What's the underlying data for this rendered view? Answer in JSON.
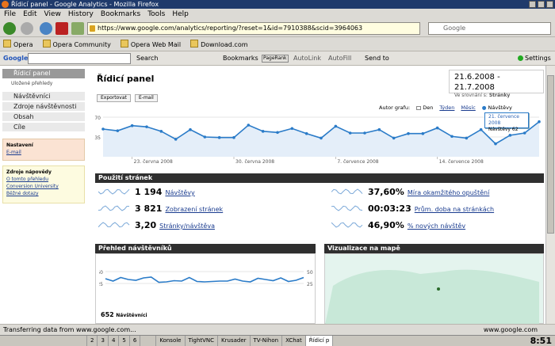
{
  "window": {
    "title": "Řídicí panel - Google Analytics - Mozilla Firefox"
  },
  "menu": [
    "File",
    "Edit",
    "View",
    "History",
    "Bookmarks",
    "Tools",
    "Help"
  ],
  "navbar": {
    "url": "https://www.google.com/analytics/reporting/?reset=1&id=7910388&scid=3964063",
    "search_placeholder": "Google"
  },
  "bookmarks": [
    "Opera",
    "Opera Community",
    "Opera Web Mail",
    "Download.com"
  ],
  "google_toolbar": {
    "logo": "Google",
    "items": [
      "Search",
      "Bookmarks",
      "PageRank",
      "AutoLink",
      "AutoFill",
      "Send to",
      "Settings"
    ]
  },
  "sidebar": {
    "header": "Řídicí panel",
    "saved_reports": "Uložené přehledy",
    "items": [
      "Návštěvníci",
      "Zdroje návštěvnosti",
      "Obsah",
      "Cíle"
    ],
    "settings": {
      "title": "Nastavení",
      "email": "E-mail"
    },
    "help": {
      "title": "Zdroje nápovědy",
      "links": [
        "O tomto přehledu",
        "Conversion University",
        "Běžné dotazy"
      ]
    }
  },
  "main": {
    "title": "Řídicí panel",
    "date_range": "21.6.2008 - 21.7.2008",
    "compare_label": "Ve srovnání s:",
    "compare_value": "Stránky",
    "export_button": "Exportovat",
    "email_button": "E-mail",
    "graph_label": "Autor grafu:",
    "graph_options": [
      "Den",
      "Týden",
      "Měsíc"
    ],
    "metric_selector": "Návštěvy",
    "tooltip": {
      "date": "21. července 2008",
      "value": "Návštěvy 62"
    }
  },
  "chart_data": [
    {
      "type": "line",
      "title": "",
      "series": [
        {
          "name": "Návštěvy",
          "values": [
            49,
            46,
            55,
            53,
            45,
            31,
            48,
            35,
            34,
            34,
            56,
            45,
            43,
            50,
            41,
            33,
            54,
            42,
            42,
            48,
            33,
            41,
            41,
            51,
            36,
            33,
            48,
            23,
            38,
            42,
            62
          ]
        }
      ],
      "x_tick_labels": [
        "23. června 2008",
        "30. června 2008",
        "7. července 2008",
        "14. července 2008"
      ],
      "y_tick_labels": [
        "35",
        "70"
      ],
      "ylim": [
        0,
        70
      ]
    },
    {
      "type": "line",
      "title": "Přehled návštěvníků",
      "series": [
        {
          "name": "",
          "values": [
            42,
            36,
            45,
            40,
            38,
            44,
            46,
            33,
            34,
            37,
            36,
            45,
            35,
            34,
            35,
            36,
            36,
            41,
            36,
            34,
            43,
            40,
            37,
            44,
            35,
            38,
            45
          ]
        }
      ],
      "y_tick_labels": [
        "25",
        "50"
      ],
      "ylim": [
        0,
        60
      ]
    }
  ],
  "page_usage": {
    "title": "Použití stránek",
    "stats": [
      {
        "value": "1 194",
        "label": "Návštěvy"
      },
      {
        "value": "3 821",
        "label": "Zobrazení stránek"
      },
      {
        "value": "3,20",
        "label": "Stránky/návštěva"
      },
      {
        "value": "37,60%",
        "label": "Míra okamžitého opuštění"
      },
      {
        "value": "00:03:23",
        "label": "Prům. doba na stránkách"
      },
      {
        "value": "46,90%",
        "label": "% nových návštěv"
      }
    ]
  },
  "visitors_overview": {
    "title": "Přehled návštěvníků",
    "count": "652",
    "count_label": "Návštěvníci"
  },
  "map_overlay": {
    "title": "Vizualizace na mapě"
  },
  "status": {
    "text": "Transferring data from www.google.com...",
    "right": "www.google.com"
  },
  "taskbar": {
    "desktops": [
      "2",
      "3",
      "4",
      "5",
      "6"
    ],
    "tasks": [
      "Konsole",
      "TightVNC",
      "Krusader",
      "TV-Nihon",
      "XChat",
      "Řídicí p"
    ],
    "clock": "8:51"
  },
  "colors": {
    "accent": "#2a7bc8",
    "section_header": "#2f2f2f",
    "link": "#1a3c8f"
  }
}
